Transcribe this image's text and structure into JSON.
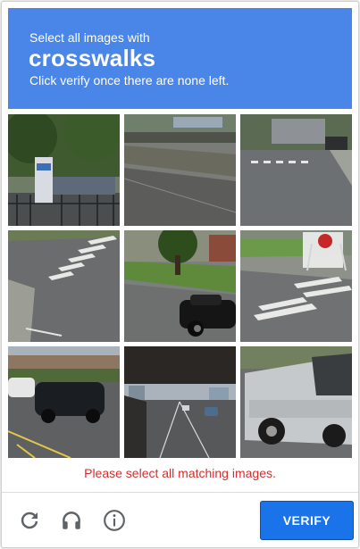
{
  "header": {
    "line1": "Select all images with",
    "target": "crosswalks",
    "line3": "Click verify once there are none left."
  },
  "tiles": [
    {
      "content": "park with sign and fence"
    },
    {
      "content": "road with bridge"
    },
    {
      "content": "intersection with crosswalk"
    },
    {
      "content": "crosswalk and curb"
    },
    {
      "content": "tree and parked car"
    },
    {
      "content": "crosswalk with stop sign"
    },
    {
      "content": "parking lot with cars"
    },
    {
      "content": "highway underpass"
    },
    {
      "content": "silver pickup truck"
    }
  ],
  "error_message": "Please select all matching images.",
  "footer": {
    "reload_icon": "reload-icon",
    "audio_icon": "headphones-icon",
    "info_icon": "info-icon",
    "verify_label": "VERIFY"
  },
  "colors": {
    "header_bg": "#4a86e8",
    "error_text": "#d32f2f",
    "verify_bg": "#1a73e8"
  }
}
